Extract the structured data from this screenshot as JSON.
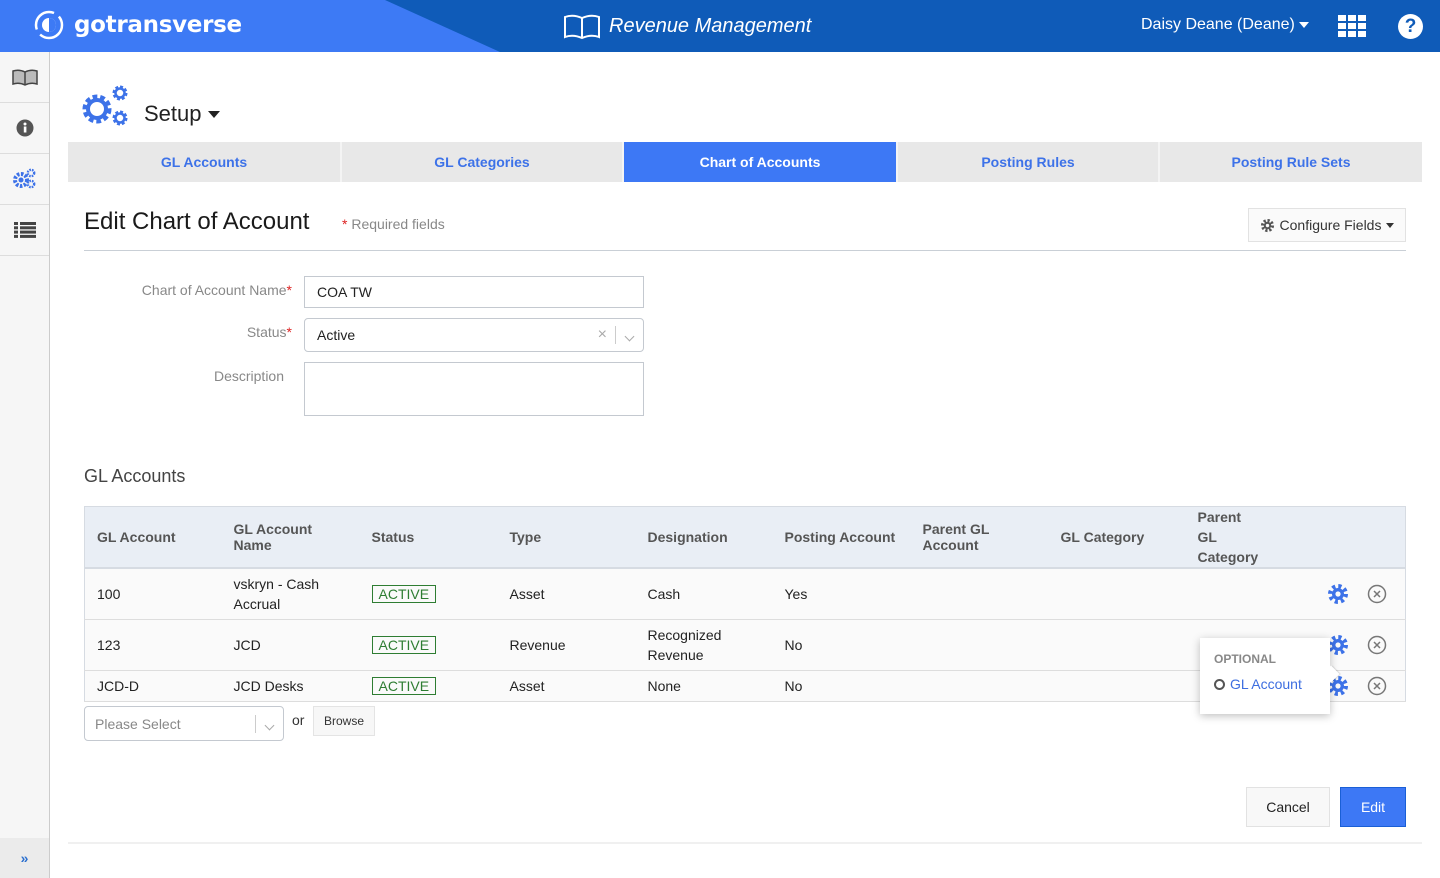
{
  "header": {
    "brand": "gotransverse",
    "app_title": "Revenue Management",
    "user": "Daisy Deane (Deane)",
    "apps_icon": "grid-icon",
    "help_icon": "question-circle-icon"
  },
  "sidebar": {
    "items": [
      {
        "icon": "book-icon"
      },
      {
        "icon": "info-icon"
      },
      {
        "icon": "gears-icon"
      },
      {
        "icon": "list-icon"
      }
    ],
    "expand_icon": "double-chevron-right-icon",
    "expand_label": "»"
  },
  "setup": {
    "label": "Setup"
  },
  "tabs": [
    {
      "label": "GL Accounts",
      "active": false
    },
    {
      "label": "GL Categories",
      "active": false
    },
    {
      "label": "Chart of Accounts",
      "active": true
    },
    {
      "label": "Posting Rules",
      "active": false
    },
    {
      "label": "Posting Rule Sets",
      "active": false
    }
  ],
  "form": {
    "title": "Edit Chart of Account",
    "required_star": "*",
    "required_note": "Required fields",
    "configure_fields": "Configure Fields",
    "fields": {
      "name_label": "Chart of Account Name",
      "name_value": "COA TW",
      "status_label": "Status",
      "status_value": "Active",
      "description_label": "Description",
      "description_value": ""
    }
  },
  "gl_accounts": {
    "title": "GL Accounts",
    "columns": [
      "GL Account",
      "GL Account Name",
      "Status",
      "Type",
      "Designation",
      "Posting Account",
      "Parent GL Account",
      "GL Category",
      "Parent GL Category"
    ],
    "rows": [
      {
        "account": "100",
        "name": "vskryn - Cash Accrual",
        "status": "ACTIVE",
        "type": "Asset",
        "designation": "Cash",
        "posting": "Yes",
        "parent_account": "",
        "category": "",
        "parent_category": ""
      },
      {
        "account": "123",
        "name": "JCD",
        "status": "ACTIVE",
        "type": "Revenue",
        "designation": "Recognized Revenue",
        "posting": "No",
        "parent_account": "",
        "category": "",
        "parent_category": ""
      },
      {
        "account": "JCD-D",
        "name": "JCD Desks",
        "status": "ACTIVE",
        "type": "Asset",
        "designation": "None",
        "posting": "No",
        "parent_account": "",
        "category": "",
        "parent_category": ""
      }
    ],
    "popover": {
      "heading": "OPTIONAL",
      "item": "GL Account"
    },
    "add_select_placeholder": "Please Select",
    "or_text": "or",
    "browse_label": "Browse"
  },
  "actions": {
    "cancel": "Cancel",
    "edit": "Edit"
  },
  "colors": {
    "brand_blue": "#3d7af5",
    "header_dark": "#0f5bb8",
    "status_green": "#2e7d32"
  }
}
